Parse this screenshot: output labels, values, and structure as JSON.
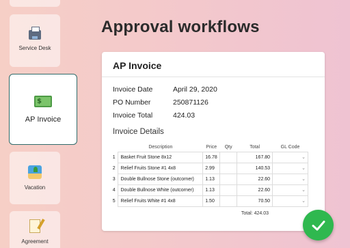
{
  "sidebar": {
    "items": [
      {
        "label": "",
        "icon": "empty-card"
      },
      {
        "label": "Service Desk",
        "icon": "printer-icon"
      },
      {
        "label": "AP Invoice",
        "icon": "money-icon"
      },
      {
        "label": "Vacation",
        "icon": "beach-icon"
      },
      {
        "label": "Agreement",
        "icon": "memo-icon"
      }
    ]
  },
  "page": {
    "title": "Approval workflows"
  },
  "invoice": {
    "title": "AP Invoice",
    "fields": [
      {
        "label": "Invoice Date",
        "value": "April 29, 2020"
      },
      {
        "label": "PO Number",
        "value": "250871126"
      },
      {
        "label": "Invoice Total",
        "value": "424.03"
      }
    ],
    "details_title": "Invoice Details",
    "columns": [
      "",
      "Description",
      "Price",
      "Qty",
      "Total",
      "GL Code"
    ],
    "rows": [
      {
        "n": "1",
        "desc": "Basket Fruit Stone 8x12",
        "price": "16.78",
        "qty": "",
        "total": "167.80",
        "gl": "⌄"
      },
      {
        "n": "2",
        "desc": "Relief Fruits Stone #1 4x8",
        "price": "2.99",
        "qty": "",
        "total": "140.53",
        "gl": "⌄"
      },
      {
        "n": "3",
        "desc": "Double Bullnose Stone (outcorner)",
        "price": "1.13",
        "qty": "",
        "total": "22.60",
        "gl": "⌄"
      },
      {
        "n": "4",
        "desc": "Double Bullnose White (outcorner)",
        "price": "1.13",
        "qty": "",
        "total": "22.60",
        "gl": "⌄"
      },
      {
        "n": "5",
        "desc": "Relief Fruits White #1 4x8",
        "price": "1.50",
        "qty": "",
        "total": "70.50",
        "gl": "⌄"
      }
    ],
    "grand_total": "Total: 424.03"
  },
  "approve_button": {
    "icon": "checkmark-icon",
    "color": "#2fb84f"
  },
  "colors": {
    "accent": "#2f6b6a",
    "approve": "#2fb84f"
  }
}
